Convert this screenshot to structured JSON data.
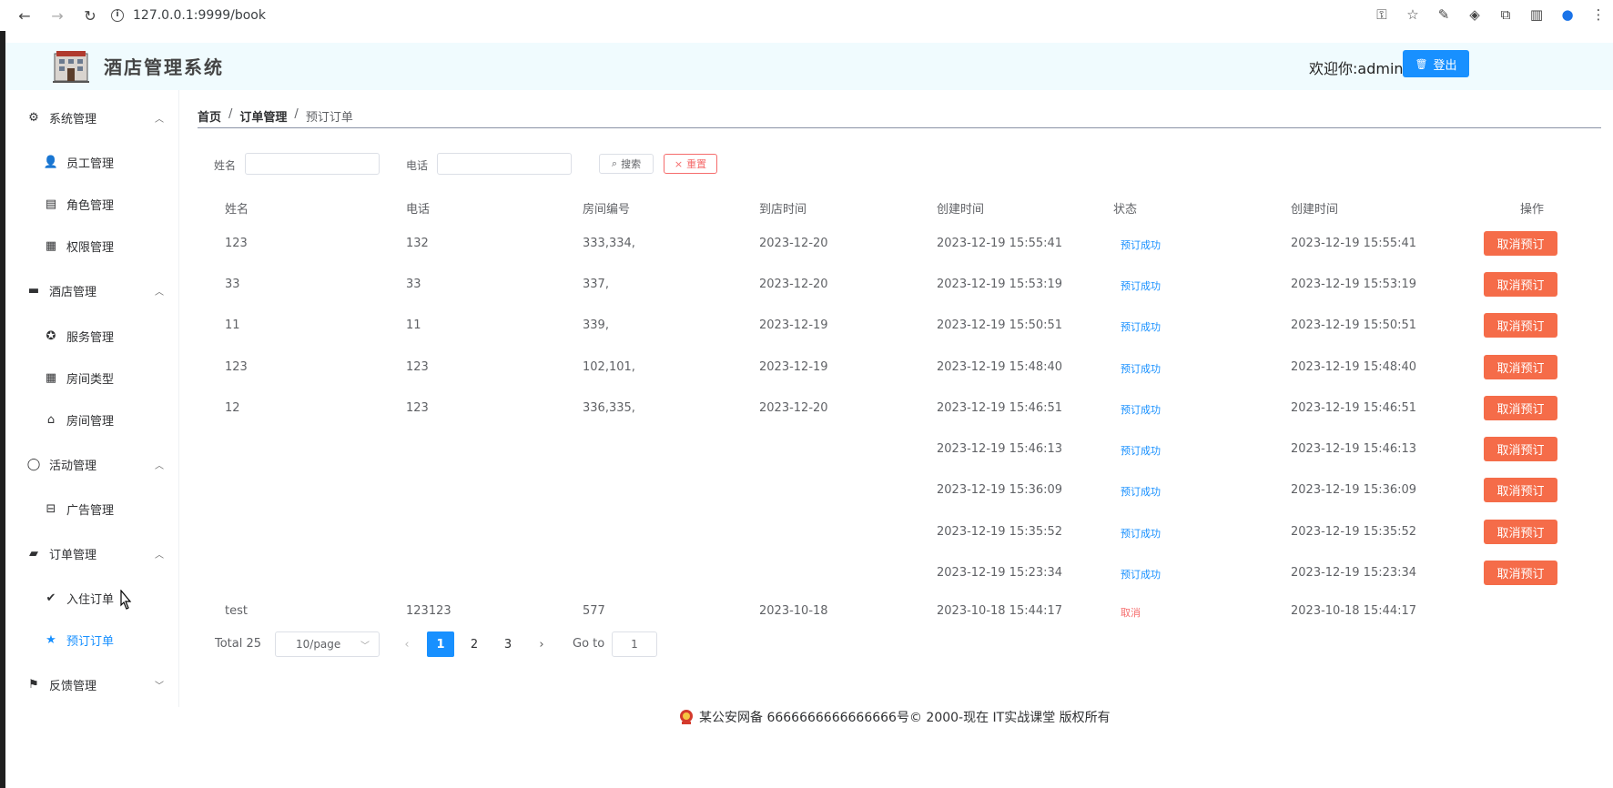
{
  "browser": {
    "url": "127.0.0.1:9999/book"
  },
  "header": {
    "brand": "酒店管理系统",
    "welcome": "欢迎你:admin",
    "logout_label": "登出"
  },
  "sidebar": {
    "groups": [
      {
        "label": "系统管理",
        "icon": "gear-icon",
        "expanded": true,
        "items": [
          {
            "label": "员工管理",
            "icon": "user-icon"
          },
          {
            "label": "角色管理",
            "icon": "clipboard-icon"
          },
          {
            "label": "权限管理",
            "icon": "grid-icon"
          }
        ]
      },
      {
        "label": "酒店管理",
        "icon": "bed-icon",
        "expanded": true,
        "items": [
          {
            "label": "服务管理",
            "icon": "service-icon"
          },
          {
            "label": "房间类型",
            "icon": "menu-grid-icon"
          },
          {
            "label": "房间管理",
            "icon": "home-icon"
          }
        ]
      },
      {
        "label": "活动管理",
        "icon": "chat-icon",
        "expanded": true,
        "items": [
          {
            "label": "广告管理",
            "icon": "box-icon"
          }
        ]
      },
      {
        "label": "订单管理",
        "icon": "bag-icon",
        "expanded": true,
        "items": [
          {
            "label": "入住订单",
            "icon": "check-circle-icon"
          },
          {
            "label": "预订订单",
            "icon": "star-icon",
            "active": true
          }
        ]
      },
      {
        "label": "反馈管理",
        "icon": "bookmark-icon",
        "expanded": false,
        "items": []
      }
    ]
  },
  "breadcrumb": [
    "首页",
    "订单管理",
    "预订订单"
  ],
  "filters": {
    "name_label": "姓名",
    "phone_label": "电话",
    "search_label": "搜索",
    "reset_label": "重置"
  },
  "table": {
    "columns": [
      "姓名",
      "电话",
      "房间编号",
      "到店时间",
      "创建时间",
      "状态",
      "创建时间",
      "操作"
    ],
    "action_label": "取消预订",
    "rows": [
      {
        "name": "123",
        "phone": "132",
        "rooms": "333,334,",
        "arrival": "2023-12-20",
        "created": "2023-12-19 15:55:41",
        "status": "预订成功",
        "created2": "2023-12-19 15:55:41",
        "action": true
      },
      {
        "name": "33",
        "phone": "33",
        "rooms": "337,",
        "arrival": "2023-12-20",
        "created": "2023-12-19 15:53:19",
        "status": "预订成功",
        "created2": "2023-12-19 15:53:19",
        "action": true
      },
      {
        "name": "11",
        "phone": "11",
        "rooms": "339,",
        "arrival": "2023-12-19",
        "created": "2023-12-19 15:50:51",
        "status": "预订成功",
        "created2": "2023-12-19 15:50:51",
        "action": true
      },
      {
        "name": "123",
        "phone": "123",
        "rooms": "102,101,",
        "arrival": "2023-12-19",
        "created": "2023-12-19 15:48:40",
        "status": "预订成功",
        "created2": "2023-12-19 15:48:40",
        "action": true
      },
      {
        "name": "12",
        "phone": "123",
        "rooms": "336,335,",
        "arrival": "2023-12-20",
        "created": "2023-12-19 15:46:51",
        "status": "预订成功",
        "created2": "2023-12-19 15:46:51",
        "action": true
      },
      {
        "name": "",
        "phone": "",
        "rooms": "",
        "arrival": "",
        "created": "2023-12-19 15:46:13",
        "status": "预订成功",
        "created2": "2023-12-19 15:46:13",
        "action": true
      },
      {
        "name": "",
        "phone": "",
        "rooms": "",
        "arrival": "",
        "created": "2023-12-19 15:36:09",
        "status": "预订成功",
        "created2": "2023-12-19 15:36:09",
        "action": true
      },
      {
        "name": "",
        "phone": "",
        "rooms": "",
        "arrival": "",
        "created": "2023-12-19 15:35:52",
        "status": "预订成功",
        "created2": "2023-12-19 15:35:52",
        "action": true
      },
      {
        "name": "",
        "phone": "",
        "rooms": "",
        "arrival": "",
        "created": "2023-12-19 15:23:34",
        "status": "预订成功",
        "created2": "2023-12-19 15:23:34",
        "action": true
      },
      {
        "name": "test",
        "phone": "123123",
        "rooms": "577",
        "arrival": "2023-10-18",
        "created": "2023-10-18 15:44:17",
        "status": "取消",
        "created2": "2023-10-18 15:44:17",
        "action": false
      }
    ]
  },
  "pagination": {
    "total": "Total 25",
    "page_size": "10/page",
    "pages": [
      "1",
      "2",
      "3"
    ],
    "current": "1",
    "goto_label": "Go to",
    "goto_value": "1"
  },
  "footer": {
    "text": "某公安网备 6666666666666666号© 2000-现在 IT实战课堂 版权所有"
  },
  "colors": {
    "primary": "#1890ff",
    "danger": "#f56c49",
    "header_bg": "#f0fbfe"
  }
}
